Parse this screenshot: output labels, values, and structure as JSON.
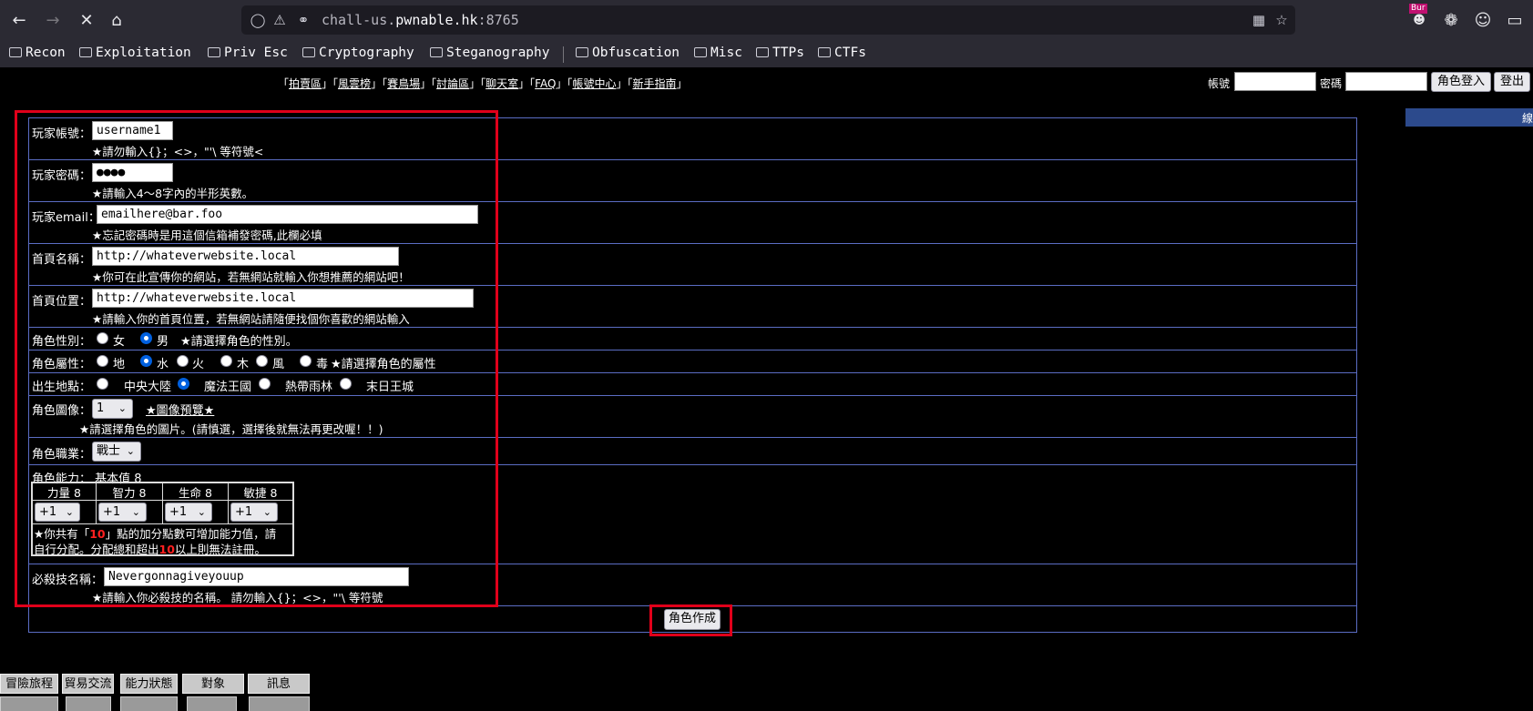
{
  "browser": {
    "url_host": "chall-us.",
    "url_domain": "pwnable.hk",
    "url_port": ":8765",
    "bookmarks": [
      "Recon",
      "Exploitation",
      "Priv Esc",
      "Cryptography",
      "Steganography",
      "Obfuscation",
      "Misc",
      "TTPs",
      "CTFs"
    ],
    "ext_badge": "Bur"
  },
  "toplinks": {
    "items": [
      "拍賣區",
      "風雲榜",
      "賽鳥場",
      "討論區",
      "聊天室",
      "FAQ",
      "帳號中心",
      "新手指南"
    ],
    "account_label": "帳號",
    "password_label": "密碼",
    "login_button": "角色登入",
    "logout_button": "登出",
    "bluebar_text": "線"
  },
  "form": {
    "username_label": "玩家帳號：",
    "username_value": "username1",
    "username_hint": "★請勿輸入{}；<>，\"'\\ 等符號<",
    "password_label": "玩家密碼：",
    "password_value": "●●●●",
    "password_hint": "★請輸入4～8字內的半形英數。",
    "email_label": "玩家email：",
    "email_value": "emailhere@bar.foo",
    "email_hint": "★忘記密碼時是用這個信箱補發密碼,此欄必填",
    "homepage_name_label": "首頁名稱：",
    "homepage_name_value": "http://whateverwebsite.local",
    "homepage_name_hint": "★你可在此宣傳你的網站，若無網站就輸入你想推薦的網站吧！",
    "homepage_url_label": "首頁位置：",
    "homepage_url_value": "http://whateverwebsite.local",
    "homepage_url_hint": "★請輸入你的首頁位置，若無網站請隨便找個你喜歡的網站輸入",
    "gender_label": "角色性別：",
    "gender_female": "女",
    "gender_male": "男",
    "gender_hint": "★請選擇角色的性別。",
    "element_label": "角色屬性：",
    "elements": [
      "地",
      "水",
      "火",
      "木",
      "風",
      "毒"
    ],
    "element_hint": "★請選擇角色的屬性",
    "birthplace_label": "出生地點：",
    "birthplaces": [
      "中央大陸",
      "魔法王國",
      "熱帶雨林",
      "末日王城"
    ],
    "image_label": "角色圖像：",
    "image_value": "1",
    "image_preview": "★圖像預覽★",
    "image_hint": "★請選擇角色的圖片。(請慎選，選擇後就無法再更改喔！！)",
    "job_label": "角色職業：",
    "job_value": "戰士",
    "ability_label": "角色能力：",
    "ability_base": "基本值 8",
    "stats": [
      "力量 8",
      "智力 8",
      "生命 8",
      "敏捷 8"
    ],
    "stat_selects": [
      "+1",
      "+1",
      "+1",
      "+1"
    ],
    "points_text_1": "★你共有「",
    "points_value": "10",
    "points_text_2": "」點的加分點數可增加能力值，請",
    "points_text_3": "自行分配。分配總和超出",
    "points_value_2": "10",
    "points_text_4": "以上則無法註冊。",
    "skill_label": "必殺技名稱：",
    "skill_value": "Nevergonnagiveyouup",
    "skill_hint": "★請輸入你必殺技的名稱。 請勿輸入{}；<>，\"'\\ 等符號",
    "submit_button": "角色作成"
  },
  "bottom_menu": [
    "冒險旅程",
    "貿易交流",
    "能力狀態",
    "對象",
    "訊息"
  ]
}
